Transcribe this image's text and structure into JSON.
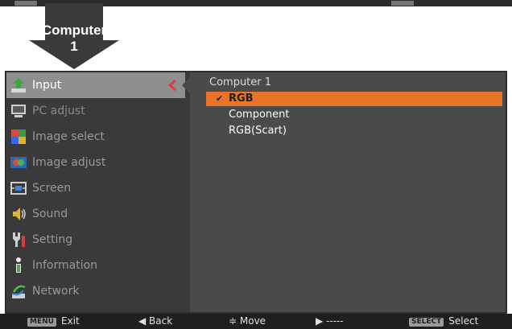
{
  "callout": {
    "label": "Computer 1"
  },
  "sidebar": {
    "items": [
      {
        "label": "Input",
        "icon": "input-icon"
      },
      {
        "label": "PC adjust",
        "icon": "monitor-icon"
      },
      {
        "label": "Image select",
        "icon": "image-select-icon"
      },
      {
        "label": "Image adjust",
        "icon": "image-adjust-icon"
      },
      {
        "label": "Screen",
        "icon": "screen-icon"
      },
      {
        "label": "Sound",
        "icon": "speaker-icon"
      },
      {
        "label": "Setting",
        "icon": "wrench-icon"
      },
      {
        "label": "Information",
        "icon": "info-icon"
      },
      {
        "label": "Network",
        "icon": "network-icon"
      }
    ],
    "active_index": 0
  },
  "panel": {
    "title": "Computer 1",
    "options": [
      {
        "label": "RGB",
        "selected": true
      },
      {
        "label": "Component",
        "selected": false
      },
      {
        "label": "RGB(Scart)",
        "selected": false
      }
    ]
  },
  "footer": {
    "exit_key": "MENU",
    "exit_label": "Exit",
    "back_label": "◀ Back",
    "move_label": "≑ Move",
    "next_label": "▶ -----",
    "select_key": "SELECT",
    "select_label": "Select"
  },
  "colors": {
    "accent": "#e8732a",
    "active_item": "#8f8f8f",
    "panel": "#4a4a4a",
    "menu_bg": "#3a3a3a"
  }
}
